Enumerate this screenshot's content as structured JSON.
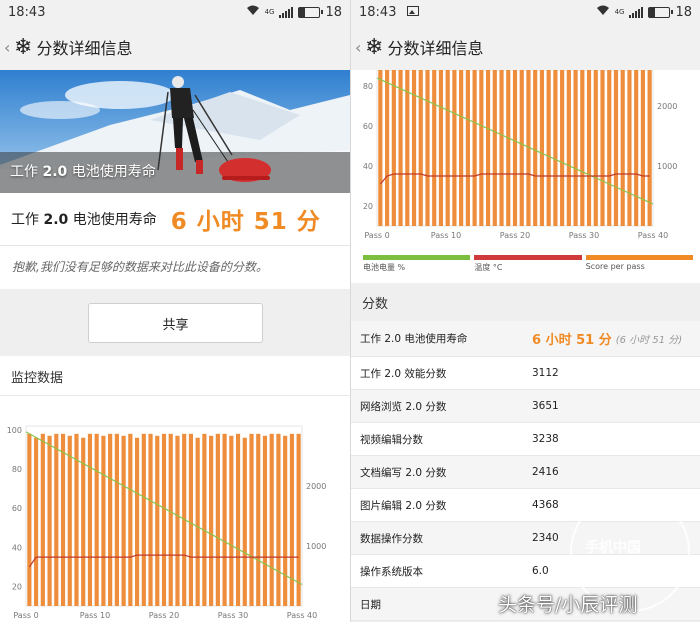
{
  "left": {
    "status": {
      "time": "18:43",
      "battery": "18",
      "network": "4G"
    },
    "appbar": {
      "title": "分数详细信息"
    },
    "hero": {
      "label_prefix": "工作",
      "label_version": "2.0",
      "label_suffix": "电池使用寿命"
    },
    "life": {
      "label_prefix": "工作",
      "label_version": "2.0",
      "label_suffix": "电池使用寿命",
      "value": "6 小时 51 分"
    },
    "note": "抱歉,我们没有足够的数据来对比此设备的分数。",
    "share_button": "共享",
    "monitor_title": "监控数据"
  },
  "right": {
    "status": {
      "time": "18:43",
      "battery": "18",
      "network": "4G"
    },
    "appbar": {
      "title": "分数详细信息"
    },
    "legend": [
      "电池电量 %",
      "温度 °C",
      "Score per pass"
    ],
    "scores_title": "分数",
    "scores": [
      {
        "name": "工作 2.0 电池使用寿命",
        "value": "6 小时 51 分",
        "extra": "(6 小时 51 分)",
        "highlight": true
      },
      {
        "name": "工作 2.0 效能分数",
        "value": "3112"
      },
      {
        "name": "网络浏览 2.0 分数",
        "value": "3651"
      },
      {
        "name": "视频编辑分数",
        "value": "3238"
      },
      {
        "name": "文档编写 2.0 分数",
        "value": "2416"
      },
      {
        "name": "图片编辑 2.0 分数",
        "value": "4368"
      },
      {
        "name": "数据操作分数",
        "value": "2340"
      },
      {
        "name": "操作系统版本",
        "value": "6.0"
      },
      {
        "name": "日期",
        "value": ""
      }
    ]
  },
  "watermark": {
    "brand": "手机中国",
    "domain": "CNMO.COM",
    "credit": "头条号/小辰评测"
  },
  "colors": {
    "accent": "#f08a24",
    "bar": "#ee8e3c",
    "battery_line": "#8bc34a",
    "temp_line": "#c0392b",
    "legend_battery": "#7cbf3f",
    "legend_temp": "#d03a3a",
    "legend_score": "#f08a24"
  },
  "chart_data": [
    {
      "type": "bar",
      "title": "",
      "x_ticks": [
        "Pass 0",
        "Pass 10",
        "Pass 20",
        "Pass 30",
        "Pass 40"
      ],
      "y_left_ticks": [
        20,
        40,
        60,
        80,
        100
      ],
      "y_right_ticks": [
        1000,
        2000
      ],
      "ylim_left": [
        10,
        102
      ],
      "ylim_right": [
        0,
        3000
      ],
      "legend": [
        "电池电量 %",
        "温度 °C",
        "Score per pass"
      ],
      "series": [
        {
          "name": "Score per pass",
          "values": [
            98,
            96,
            98,
            97,
            98,
            98,
            97,
            98,
            96,
            98,
            98,
            97,
            98,
            98,
            97,
            98,
            96,
            98,
            98,
            97,
            98,
            98,
            97,
            98,
            98,
            96,
            98,
            97,
            98,
            98,
            97,
            98,
            96,
            98,
            98,
            97,
            98,
            98,
            97,
            98,
            98
          ]
        },
        {
          "name": "电池电量 %",
          "start": 99,
          "end": 21
        },
        {
          "name": "温度 °C",
          "values": [
            30,
            35,
            35,
            35,
            35,
            35,
            35,
            35,
            35,
            35,
            35,
            35,
            35,
            35,
            35,
            35,
            36,
            36,
            36,
            36,
            36,
            36,
            36,
            36,
            35,
            35,
            35,
            35,
            35,
            35,
            35,
            35,
            35,
            35,
            35,
            35,
            35,
            35,
            35,
            35,
            35
          ]
        }
      ]
    },
    {
      "type": "bar",
      "title": "",
      "x_ticks": [
        "Pass 0",
        "Pass 10",
        "Pass 20",
        "Pass 30",
        "Pass 40"
      ],
      "y_left_ticks": [
        20,
        40,
        60,
        80
      ],
      "y_right_ticks": [
        1000,
        2000
      ],
      "ylim_left": [
        10,
        88
      ],
      "ylim_right": [
        0,
        2600
      ],
      "series": [
        {
          "name": "Score per pass",
          "values": [
            88,
            88,
            88,
            88,
            88,
            88,
            88,
            88,
            88,
            88,
            88,
            88,
            88,
            88,
            88,
            88,
            88,
            88,
            88,
            88,
            88,
            88,
            88,
            88,
            88,
            88,
            88,
            88,
            88,
            88,
            88,
            88,
            88,
            88,
            88,
            88,
            88,
            88,
            88,
            88,
            88
          ]
        },
        {
          "name": "电池电量 %",
          "start": 84,
          "end": 21
        },
        {
          "name": "温度 °C",
          "values": [
            31,
            35,
            36,
            36,
            36,
            36,
            36,
            35,
            35,
            35,
            35,
            35,
            35,
            35,
            35,
            36,
            36,
            36,
            36,
            36,
            36,
            36,
            36,
            35,
            35,
            35,
            35,
            35,
            35,
            35,
            35,
            35,
            35,
            35,
            35,
            36,
            36,
            36,
            36,
            35,
            35
          ]
        }
      ]
    }
  ]
}
